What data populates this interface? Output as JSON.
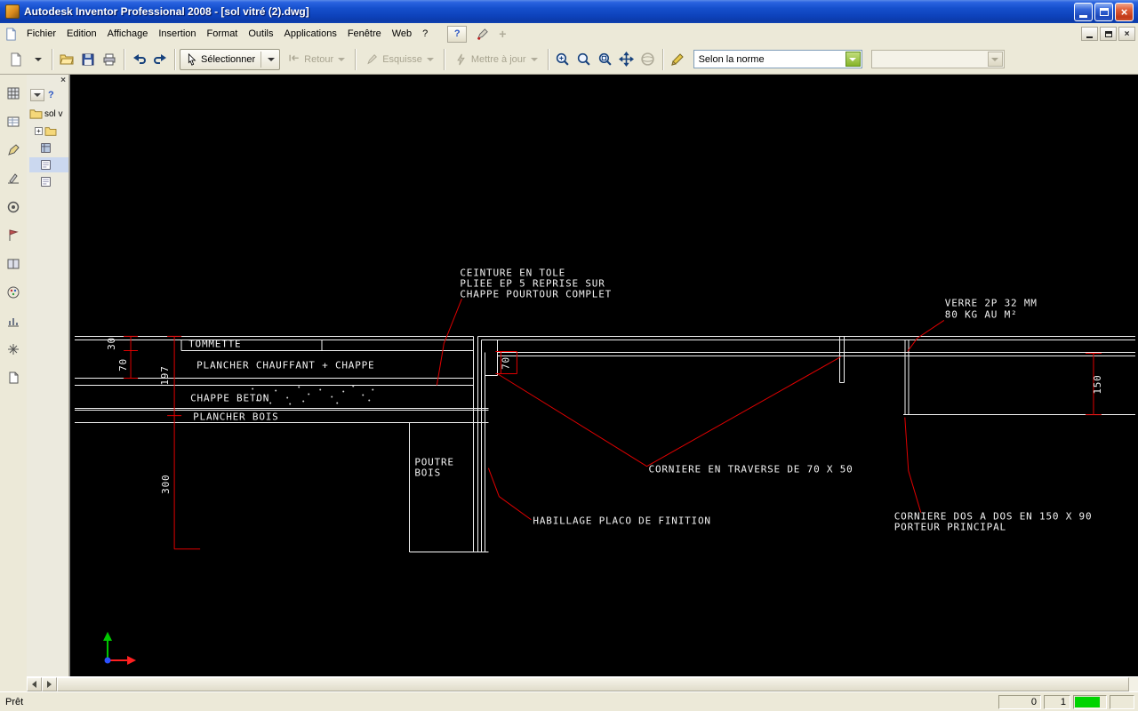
{
  "window": {
    "title": "Autodesk Inventor Professional 2008 - [sol vitré (2).dwg]"
  },
  "menubar": {
    "items": [
      "Fichier",
      "Edition",
      "Affichage",
      "Insertion",
      "Format",
      "Outils",
      "Applications",
      "Fenêtre",
      "Web",
      "?"
    ]
  },
  "toolbar": {
    "select": "Sélectionner",
    "retour": "Retour",
    "esquisse": "Esquisse",
    "update": "Mettre à jour",
    "norm": "Selon la norme"
  },
  "browser": {
    "root": "sol v"
  },
  "drawing": {
    "notes": {
      "ceinture1": "CEINTURE EN TOLE",
      "ceinture2": "PLIEE EP 5 REPRISE SUR",
      "ceinture3": "CHAPPE POURTOUR COMPLET",
      "verre1": "VERRE 2P 32 MM",
      "verre2": "80 KG AU M²",
      "tommette": "TOMMETTE",
      "plancher_chauffant": "PLANCHER CHAUFFANT + CHAPPE",
      "chappe_beton": "CHAPPE BETON",
      "plancher_bois": "PLANCHER BOIS",
      "poutre1": "POUTRE",
      "poutre2": "BOIS",
      "corniere_traverse": "CORNIERE EN TRAVERSE DE 70 X 50",
      "habillage": "HABILLAGE PLACO DE FINITION",
      "corniere_dos1": "CORNIERE DOS A DOS EN 150 X 90",
      "corniere_dos2": "PORTEUR PRINCIPAL"
    },
    "dims": {
      "d30": "30",
      "d70a": "70",
      "d197": "197",
      "d300": "300",
      "d70b": "70",
      "d150": "150"
    }
  },
  "statusbar": {
    "ready": "Prêt",
    "field1": "0",
    "field2": "1"
  },
  "icons": {
    "close": "×",
    "help": "?",
    "plus": "+"
  },
  "colors": {
    "annotation_red": "#e00000",
    "drawing_white": "#f2f2f2",
    "canvas_black": "#000000",
    "progress_green": "#00d400",
    "titlebar_blue": "#0d42bb"
  }
}
